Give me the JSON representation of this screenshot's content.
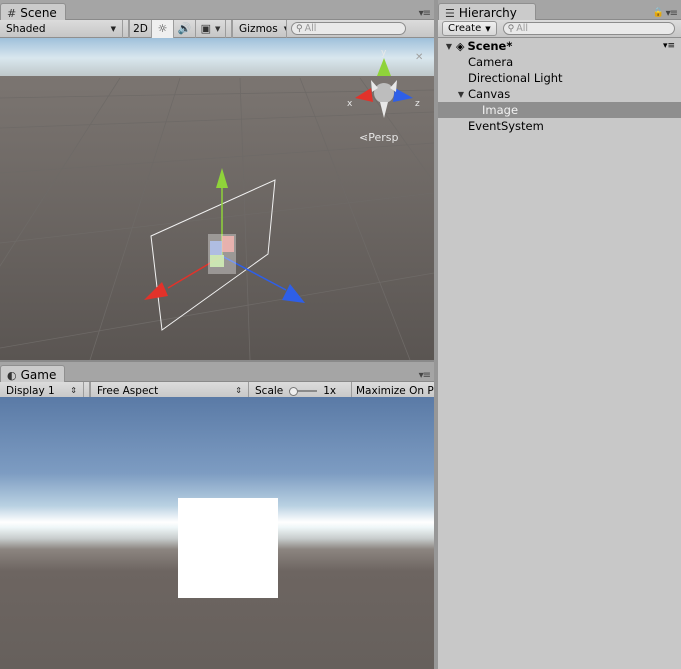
{
  "scene_panel": {
    "tab_label": "Scene",
    "tab_icon": "grid-icon",
    "shading_mode": "Shaded",
    "mode_2d_label": "2D",
    "gizmos_label": "Gizmos",
    "search_placeholder": "All",
    "persp_label": "Persp",
    "gizmo_axes": {
      "x": "x",
      "y": "y",
      "z": "z"
    },
    "colors": {
      "x_axis": "#e2322a",
      "y_axis": "#8fd33a",
      "z_axis": "#2e5fe8"
    }
  },
  "game_panel": {
    "tab_label": "Game",
    "tab_icon": "pacman-icon",
    "display": "Display 1",
    "aspect": "Free Aspect",
    "scale_label": "Scale",
    "scale_value": "1x",
    "maximize_label": "Maximize On Play"
  },
  "hierarchy": {
    "tab_label": "Hierarchy",
    "create_label": "Create",
    "search_placeholder": "All",
    "items": [
      {
        "label": "Scene*",
        "depth": 0,
        "foldable": true,
        "selected": false
      },
      {
        "label": "Camera",
        "depth": 1,
        "foldable": false,
        "selected": false
      },
      {
        "label": "Directional Light",
        "depth": 1,
        "foldable": false,
        "selected": false
      },
      {
        "label": "Canvas",
        "depth": 1,
        "foldable": true,
        "selected": false
      },
      {
        "label": "Image",
        "depth": 2,
        "foldable": false,
        "selected": true
      },
      {
        "label": "EventSystem",
        "depth": 1,
        "foldable": false,
        "selected": false
      }
    ]
  }
}
